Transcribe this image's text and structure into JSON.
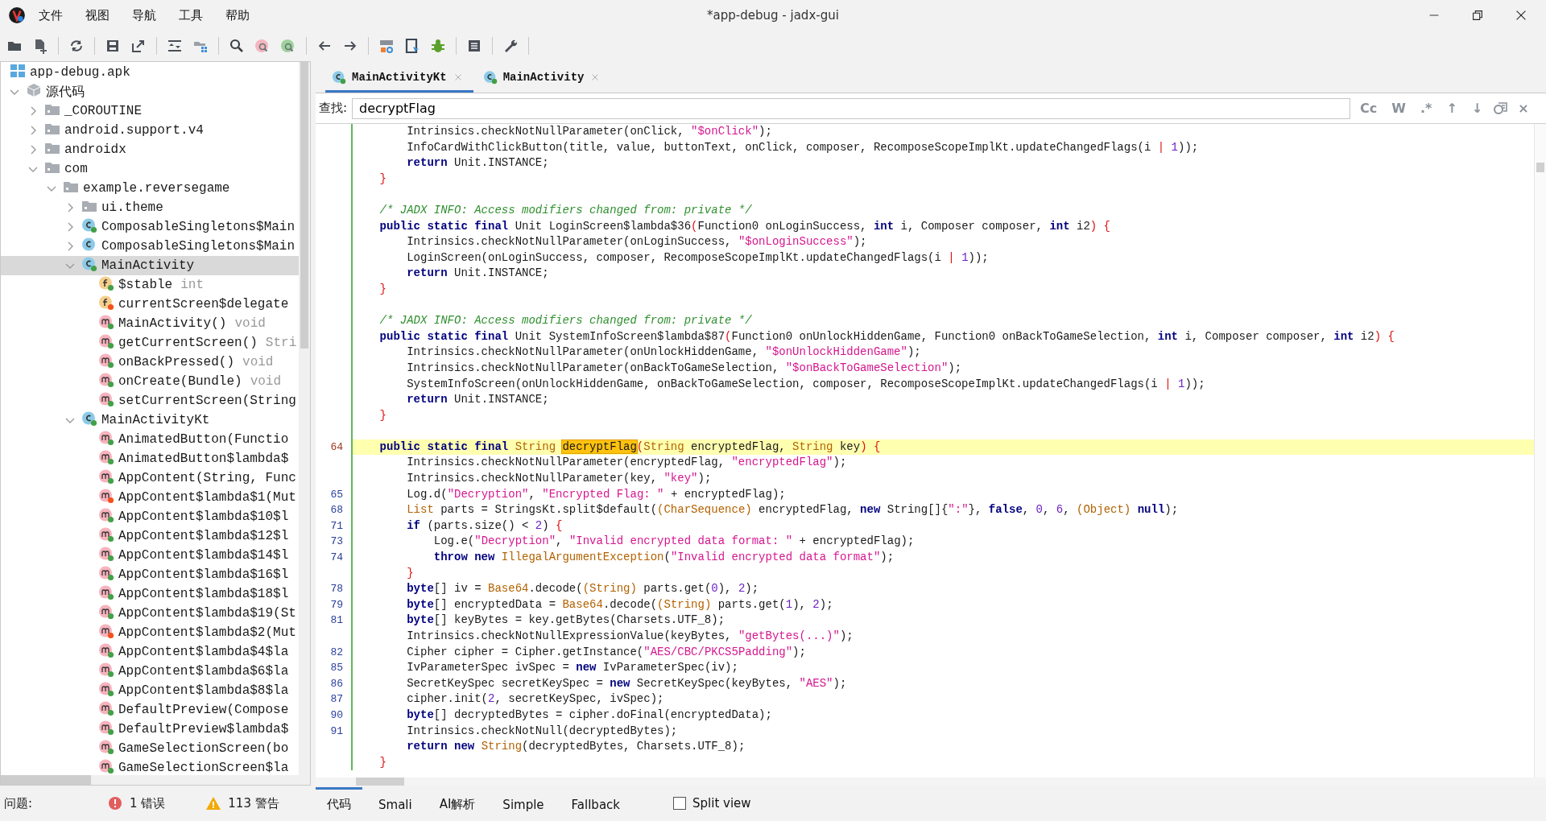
{
  "window": {
    "title": "*app-debug - jadx-gui"
  },
  "menu": [
    "文件",
    "视图",
    "导航",
    "工具",
    "帮助"
  ],
  "tree": [
    {
      "label": "app-debug.apk",
      "kind": "apk",
      "selected": false
    },
    {
      "label": "源代码",
      "kind": "source",
      "expanded": true,
      "selected": false,
      "children": [
        {
          "label": "_COROUTINE",
          "kind": "package",
          "expanded": false,
          "selected": false
        },
        {
          "label": "android.support.v4",
          "kind": "package",
          "expanded": false,
          "selected": false
        },
        {
          "label": "androidx",
          "kind": "package",
          "expanded": false,
          "selected": false
        },
        {
          "label": "com",
          "kind": "package",
          "expanded": true,
          "selected": false,
          "children": [
            {
              "label": "example.reversegame",
              "kind": "package",
              "expanded": true,
              "selected": false,
              "children": [
                {
                  "label": "ui.theme",
                  "kind": "package",
                  "expanded": false,
                  "selected": false
                },
                {
                  "label": "ComposableSingletons$Main",
                  "kind": "class",
                  "color": "#43a047",
                  "expanded": false,
                  "selected": false
                },
                {
                  "label": "ComposableSingletons$Main",
                  "kind": "class",
                  "expanded": false,
                  "selected": false
                },
                {
                  "label": "MainActivity",
                  "kind": "class",
                  "color": "#43a047",
                  "expanded": true,
                  "selected": true,
                  "children": [
                    {
                      "label": "$stable",
                      "type": "int",
                      "kind": "field",
                      "color": "#43a047",
                      "selected": false
                    },
                    {
                      "label": "currentScreen$delegate",
                      "kind": "field",
                      "color": "#f4511e",
                      "selected": false
                    },
                    {
                      "label": "MainActivity()",
                      "type": "void",
                      "kind": "method",
                      "color": "#43a047",
                      "selected": false
                    },
                    {
                      "label": "getCurrentScreen()",
                      "type": "Stri",
                      "kind": "method",
                      "color": "#43a047",
                      "selected": false
                    },
                    {
                      "label": "onBackPressed()",
                      "type": "void",
                      "kind": "method",
                      "color": "#43a047",
                      "selected": false
                    },
                    {
                      "label": "onCreate(Bundle)",
                      "type": "void",
                      "kind": "method",
                      "color": "#43a047",
                      "selected": false
                    },
                    {
                      "label": "setCurrentScreen(String",
                      "kind": "method",
                      "color": "#43a047",
                      "selected": false
                    }
                  ]
                },
                {
                  "label": "MainActivityKt",
                  "kind": "class",
                  "color": "#43a047",
                  "expanded": true,
                  "selected": false,
                  "children": [
                    {
                      "label": "AnimatedButton(Functio",
                      "kind": "method",
                      "color": "#43a047",
                      "selected": false
                    },
                    {
                      "label": "AnimatedButton$lambda$",
                      "kind": "method",
                      "color": "#43a047",
                      "selected": false
                    },
                    {
                      "label": "AppContent(String, Func",
                      "kind": "method",
                      "color": "#43a047",
                      "selected": false
                    },
                    {
                      "label": "AppContent$lambda$1(Mut",
                      "kind": "method",
                      "color": "#f4511e",
                      "selected": false
                    },
                    {
                      "label": "AppContent$lambda$10$l",
                      "kind": "method",
                      "color": "#43a047",
                      "selected": false
                    },
                    {
                      "label": "AppContent$lambda$12$l",
                      "kind": "method",
                      "color": "#43a047",
                      "selected": false
                    },
                    {
                      "label": "AppContent$lambda$14$l",
                      "kind": "method",
                      "color": "#43a047",
                      "selected": false
                    },
                    {
                      "label": "AppContent$lambda$16$l",
                      "kind": "method",
                      "color": "#43a047",
                      "selected": false
                    },
                    {
                      "label": "AppContent$lambda$18$l",
                      "kind": "method",
                      "color": "#43a047",
                      "selected": false
                    },
                    {
                      "label": "AppContent$lambda$19(St",
                      "kind": "method",
                      "color": "#43a047",
                      "selected": false
                    },
                    {
                      "label": "AppContent$lambda$2(Mut",
                      "kind": "method",
                      "color": "#f4511e",
                      "selected": false
                    },
                    {
                      "label": "AppContent$lambda$4$la",
                      "kind": "method",
                      "color": "#43a047",
                      "selected": false
                    },
                    {
                      "label": "AppContent$lambda$6$la",
                      "kind": "method",
                      "color": "#43a047",
                      "selected": false
                    },
                    {
                      "label": "AppContent$lambda$8$la",
                      "kind": "method",
                      "color": "#43a047",
                      "selected": false
                    },
                    {
                      "label": "DefaultPreview(Compose",
                      "kind": "method",
                      "color": "#43a047",
                      "selected": false
                    },
                    {
                      "label": "DefaultPreview$lambda$",
                      "kind": "method",
                      "color": "#43a047",
                      "selected": false
                    },
                    {
                      "label": "GameSelectionScreen(bo",
                      "kind": "method",
                      "color": "#43a047",
                      "selected": false
                    },
                    {
                      "label": "GameSelectionScreen$la",
                      "kind": "method",
                      "color": "#43a047",
                      "selected": false
                    }
                  ]
                }
              ]
            }
          ]
        }
      ]
    }
  ],
  "status": {
    "label": "问题:",
    "errors": "1 错误",
    "warnings": "113 警告"
  },
  "tabs": [
    {
      "label": "MainActivityKt",
      "selected": true
    },
    {
      "label": "MainActivity",
      "selected": false
    }
  ],
  "search": {
    "label": "查找:",
    "value": "decryptFlag",
    "options": [
      "Cc",
      "W",
      ".*",
      "↑",
      "↓"
    ],
    "close": "×"
  },
  "code": [
    {
      "kind": "body",
      "current": false,
      "tokens": [
        {
          "text": "Intrinsics.checkNotNullParameter(onClick, ",
          "kind": "plain"
        },
        {
          "text": "\"$onClick\"",
          "kind": "str"
        },
        {
          "text": ");",
          "kind": "plain"
        }
      ]
    },
    {
      "kind": "body",
      "current": false,
      "tokens": [
        {
          "text": "InfoCardWithClickButton(title, value, buttonText, onClick, composer, RecomposeScopeImplKt.updateChangedFlags(i ",
          "kind": "plain"
        },
        {
          "text": "| ",
          "kind": "op"
        },
        {
          "text": "1",
          "kind": "num"
        },
        {
          "text": "));",
          "kind": "plain"
        }
      ]
    },
    {
      "kind": "body",
      "current": false,
      "tokens": [
        {
          "text": "return",
          "kind": "kw"
        },
        {
          "text": " Unit.INSTANCE;",
          "kind": "plain"
        }
      ]
    },
    {
      "kind": "member",
      "current": false,
      "tokens": [
        {
          "text": "}",
          "kind": "brace"
        }
      ]
    },
    {
      "kind": "blank",
      "current": false
    },
    {
      "kind": "member",
      "current": false,
      "tokens": [
        {
          "text": "/* JADX INFO: Access modifiers changed from: private */",
          "kind": "comment"
        }
      ]
    },
    {
      "kind": "member",
      "current": false,
      "tokens": [
        {
          "text": "public static final",
          "kind": "kw"
        },
        {
          "text": " Unit LoginScreen$lambda$36",
          "kind": "plain"
        },
        {
          "text": "(",
          "kind": "brace"
        },
        {
          "text": "Function0 onLoginSuccess, ",
          "kind": "plain"
        },
        {
          "text": "int",
          "kind": "kw"
        },
        {
          "text": " i, Composer composer, ",
          "kind": "plain"
        },
        {
          "text": "int",
          "kind": "kw"
        },
        {
          "text": " i2",
          "kind": "plain"
        },
        {
          "text": ") {",
          "kind": "brace"
        }
      ]
    },
    {
      "kind": "body",
      "current": false,
      "tokens": [
        {
          "text": "Intrinsics.checkNotNullParameter(onLoginSuccess, ",
          "kind": "plain"
        },
        {
          "text": "\"$onLoginSuccess\"",
          "kind": "str"
        },
        {
          "text": ");",
          "kind": "plain"
        }
      ]
    },
    {
      "kind": "body",
      "current": false,
      "tokens": [
        {
          "text": "LoginScreen(onLoginSuccess, composer, RecomposeScopeImplKt.updateChangedFlags(i ",
          "kind": "plain"
        },
        {
          "text": "| ",
          "kind": "op"
        },
        {
          "text": "1",
          "kind": "num"
        },
        {
          "text": "));",
          "kind": "plain"
        }
      ]
    },
    {
      "kind": "body",
      "current": false,
      "tokens": [
        {
          "text": "return",
          "kind": "kw"
        },
        {
          "text": " Unit.INSTANCE;",
          "kind": "plain"
        }
      ]
    },
    {
      "kind": "member",
      "current": false,
      "tokens": [
        {
          "text": "}",
          "kind": "brace"
        }
      ]
    },
    {
      "kind": "blank",
      "current": false
    },
    {
      "kind": "member",
      "current": false,
      "tokens": [
        {
          "text": "/* JADX INFO: Access modifiers changed from: private */",
          "kind": "comment"
        }
      ]
    },
    {
      "kind": "member",
      "current": false,
      "tokens": [
        {
          "text": "public static final",
          "kind": "kw"
        },
        {
          "text": " Unit SystemInfoScreen$lambda$87",
          "kind": "plain"
        },
        {
          "text": "(",
          "kind": "brace"
        },
        {
          "text": "Function0 onUnlockHiddenGame, Function0 onBackToGameSelection, ",
          "kind": "plain"
        },
        {
          "text": "int",
          "kind": "kw"
        },
        {
          "text": " i, Composer composer, ",
          "kind": "plain"
        },
        {
          "text": "int",
          "kind": "kw"
        },
        {
          "text": " i2",
          "kind": "plain"
        },
        {
          "text": ") {",
          "kind": "brace"
        }
      ]
    },
    {
      "kind": "body",
      "current": false,
      "tokens": [
        {
          "text": "Intrinsics.checkNotNullParameter(onUnlockHiddenGame, ",
          "kind": "plain"
        },
        {
          "text": "\"$onUnlockHiddenGame\"",
          "kind": "str"
        },
        {
          "text": ");",
          "kind": "plain"
        }
      ]
    },
    {
      "kind": "body",
      "current": false,
      "tokens": [
        {
          "text": "Intrinsics.checkNotNullParameter(onBackToGameSelection, ",
          "kind": "plain"
        },
        {
          "text": "\"$onBackToGameSelection\"",
          "kind": "str"
        },
        {
          "text": ");",
          "kind": "plain"
        }
      ]
    },
    {
      "kind": "body",
      "current": false,
      "tokens": [
        {
          "text": "SystemInfoScreen(onUnlockHiddenGame, onBackToGameSelection, composer, RecomposeScopeImplKt.updateChangedFlags(i ",
          "kind": "plain"
        },
        {
          "text": "| ",
          "kind": "op"
        },
        {
          "text": "1",
          "kind": "num"
        },
        {
          "text": "));",
          "kind": "plain"
        }
      ]
    },
    {
      "kind": "body",
      "current": false,
      "tokens": [
        {
          "text": "return",
          "kind": "kw"
        },
        {
          "text": " Unit.INSTANCE;",
          "kind": "plain"
        }
      ]
    },
    {
      "kind": "member",
      "current": false,
      "tokens": [
        {
          "text": "}",
          "kind": "brace"
        }
      ]
    },
    {
      "kind": "blank",
      "current": false
    },
    {
      "kind": "member",
      "number": "64",
      "current": true,
      "tokens": [
        {
          "text": "public static final ",
          "kind": "kw"
        },
        {
          "text": "String ",
          "kind": "type"
        },
        {
          "text": "decryptFlag",
          "kind": "match"
        },
        {
          "text": "(",
          "kind": "brace"
        },
        {
          "text": "String",
          "kind": "type"
        },
        {
          "text": " encryptedFlag, ",
          "kind": "plain"
        },
        {
          "text": "String",
          "kind": "type"
        },
        {
          "text": " key",
          "kind": "plain"
        },
        {
          "text": ") {",
          "kind": "brace"
        }
      ]
    },
    {
      "kind": "body",
      "current": false,
      "tokens": [
        {
          "text": "Intrinsics.checkNotNullParameter(encryptedFlag, ",
          "kind": "plain"
        },
        {
          "text": "\"encryptedFlag\"",
          "kind": "str"
        },
        {
          "text": ");",
          "kind": "plain"
        }
      ]
    },
    {
      "kind": "body",
      "current": false,
      "tokens": [
        {
          "text": "Intrinsics.checkNotNullParameter(key, ",
          "kind": "plain"
        },
        {
          "text": "\"key\"",
          "kind": "str"
        },
        {
          "text": ");",
          "kind": "plain"
        }
      ]
    },
    {
      "kind": "body",
      "number": "65",
      "current": false,
      "tokens": [
        {
          "text": "Log.d(",
          "kind": "plain"
        },
        {
          "text": "\"Decryption\"",
          "kind": "str"
        },
        {
          "text": ", ",
          "kind": "plain"
        },
        {
          "text": "\"Encrypted Flag: \"",
          "kind": "str"
        },
        {
          "text": " + encryptedFlag);",
          "kind": "plain"
        }
      ]
    },
    {
      "kind": "body",
      "number": "68",
      "current": false,
      "tokens": [
        {
          "text": "List",
          "kind": "type"
        },
        {
          "text": " parts = StringsKt.split$default(",
          "kind": "plain"
        },
        {
          "text": "(CharSequence)",
          "kind": "type"
        },
        {
          "text": " encryptedFlag, ",
          "kind": "plain"
        },
        {
          "text": "new",
          "kind": "kw"
        },
        {
          "text": " String[]{",
          "kind": "plain"
        },
        {
          "text": "\":\"",
          "kind": "str"
        },
        {
          "text": "}, ",
          "kind": "plain"
        },
        {
          "text": "false",
          "kind": "kw"
        },
        {
          "text": ", ",
          "kind": "plain"
        },
        {
          "text": "0",
          "kind": "num"
        },
        {
          "text": ", ",
          "kind": "plain"
        },
        {
          "text": "6",
          "kind": "num"
        },
        {
          "text": ", ",
          "kind": "plain"
        },
        {
          "text": "(Object) ",
          "kind": "type"
        },
        {
          "text": "null",
          "kind": "kw"
        },
        {
          "text": ");",
          "kind": "plain"
        }
      ]
    },
    {
      "kind": "body",
      "number": "71",
      "current": false,
      "tokens": [
        {
          "text": "if",
          "kind": "kw"
        },
        {
          "text": " (parts.size() < ",
          "kind": "plain"
        },
        {
          "text": "2",
          "kind": "num"
        },
        {
          "text": ") ",
          "kind": "plain"
        },
        {
          "text": "{",
          "kind": "brace"
        }
      ]
    },
    {
      "kind": "nested",
      "number": "73",
      "current": false,
      "tokens": [
        {
          "text": "Log.e(",
          "kind": "plain"
        },
        {
          "text": "\"Decryption\"",
          "kind": "str"
        },
        {
          "text": ", ",
          "kind": "plain"
        },
        {
          "text": "\"Invalid encrypted data format: \"",
          "kind": "str"
        },
        {
          "text": " + encryptedFlag);",
          "kind": "plain"
        }
      ]
    },
    {
      "kind": "nested",
      "number": "74",
      "current": false,
      "tokens": [
        {
          "text": "throw new ",
          "kind": "kw"
        },
        {
          "text": "IllegalArgumentException",
          "kind": "type"
        },
        {
          "text": "(",
          "kind": "plain"
        },
        {
          "text": "\"Invalid encrypted data format\"",
          "kind": "str"
        },
        {
          "text": ");",
          "kind": "plain"
        }
      ]
    },
    {
      "kind": "body",
      "current": false,
      "tokens": [
        {
          "text": "}",
          "kind": "brace"
        }
      ]
    },
    {
      "kind": "body",
      "number": "78",
      "current": false,
      "tokens": [
        {
          "text": "byte",
          "kind": "kw"
        },
        {
          "text": "[] iv = ",
          "kind": "plain"
        },
        {
          "text": "Base64",
          "kind": "type"
        },
        {
          "text": ".decode(",
          "kind": "plain"
        },
        {
          "text": "(String)",
          "kind": "type"
        },
        {
          "text": " parts.get(",
          "kind": "plain"
        },
        {
          "text": "0",
          "kind": "num"
        },
        {
          "text": "), ",
          "kind": "plain"
        },
        {
          "text": "2",
          "kind": "num"
        },
        {
          "text": ");",
          "kind": "plain"
        }
      ]
    },
    {
      "kind": "body",
      "number": "79",
      "current": false,
      "tokens": [
        {
          "text": "byte",
          "kind": "kw"
        },
        {
          "text": "[] encryptedData = ",
          "kind": "plain"
        },
        {
          "text": "Base64",
          "kind": "type"
        },
        {
          "text": ".decode(",
          "kind": "plain"
        },
        {
          "text": "(String)",
          "kind": "type"
        },
        {
          "text": " parts.get(",
          "kind": "plain"
        },
        {
          "text": "1",
          "kind": "num"
        },
        {
          "text": "), ",
          "kind": "plain"
        },
        {
          "text": "2",
          "kind": "num"
        },
        {
          "text": ");",
          "kind": "plain"
        }
      ]
    },
    {
      "kind": "body",
      "number": "81",
      "current": false,
      "tokens": [
        {
          "text": "byte",
          "kind": "kw"
        },
        {
          "text": "[] keyBytes = key.getBytes(Charsets.UTF_8);",
          "kind": "plain"
        }
      ]
    },
    {
      "kind": "body",
      "current": false,
      "tokens": [
        {
          "text": "Intrinsics.checkNotNullExpressionValue(keyBytes, ",
          "kind": "plain"
        },
        {
          "text": "\"getBytes(...)\"",
          "kind": "str"
        },
        {
          "text": ");",
          "kind": "plain"
        }
      ]
    },
    {
      "kind": "body",
      "number": "82",
      "current": false,
      "tokens": [
        {
          "text": "Cipher cipher = Cipher.getInstance(",
          "kind": "plain"
        },
        {
          "text": "\"AES/CBC/PKCS5Padding\"",
          "kind": "str"
        },
        {
          "text": ");",
          "kind": "plain"
        }
      ]
    },
    {
      "kind": "body",
      "number": "85",
      "current": false,
      "tokens": [
        {
          "text": "IvParameterSpec ivSpec = ",
          "kind": "plain"
        },
        {
          "text": "new",
          "kind": "kw"
        },
        {
          "text": " IvParameterSpec(iv);",
          "kind": "plain"
        }
      ]
    },
    {
      "kind": "body",
      "number": "86",
      "current": false,
      "tokens": [
        {
          "text": "SecretKeySpec secretKeySpec = ",
          "kind": "plain"
        },
        {
          "text": "new",
          "kind": "kw"
        },
        {
          "text": " SecretKeySpec(keyBytes, ",
          "kind": "plain"
        },
        {
          "text": "\"AES\"",
          "kind": "str"
        },
        {
          "text": ");",
          "kind": "plain"
        }
      ]
    },
    {
      "kind": "body",
      "number": "87",
      "current": false,
      "tokens": [
        {
          "text": "cipher.init(",
          "kind": "plain"
        },
        {
          "text": "2",
          "kind": "num"
        },
        {
          "text": ", secretKeySpec, ivSpec);",
          "kind": "plain"
        }
      ]
    },
    {
      "kind": "body",
      "number": "90",
      "current": false,
      "tokens": [
        {
          "text": "byte",
          "kind": "kw"
        },
        {
          "text": "[] decryptedBytes = cipher.doFinal(encryptedData);",
          "kind": "plain"
        }
      ]
    },
    {
      "kind": "body",
      "number": "91",
      "current": false,
      "tokens": [
        {
          "text": "Intrinsics.checkNotNull(decryptedBytes);",
          "kind": "plain"
        }
      ]
    },
    {
      "kind": "body",
      "current": false,
      "tokens": [
        {
          "text": "return new ",
          "kind": "kw"
        },
        {
          "text": "String",
          "kind": "type"
        },
        {
          "text": "(decryptedBytes, Charsets.UTF_8);",
          "kind": "plain"
        }
      ]
    },
    {
      "kind": "member",
      "current": false,
      "tokens": [
        {
          "text": "}",
          "kind": "brace"
        }
      ]
    }
  ],
  "view_tabs": [
    {
      "label": "代码",
      "selected": true
    },
    {
      "label": "Smali",
      "selected": false
    },
    {
      "label": "AI解析",
      "selected": false
    },
    {
      "label": "Simple",
      "selected": false
    },
    {
      "label": "Fallback",
      "selected": false
    }
  ],
  "split_view": {
    "label": "Split view",
    "checked": false
  }
}
